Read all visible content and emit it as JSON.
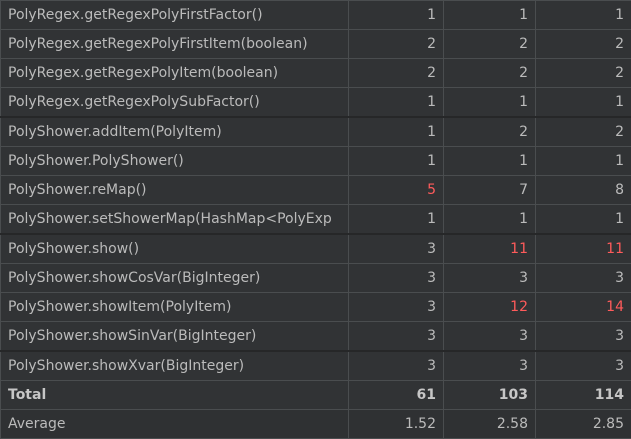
{
  "colors": {
    "background": "#313335",
    "grid": "#4a4d4f",
    "text": "#bbbbbb",
    "warning": "#ff5b5b"
  },
  "rows": [
    {
      "name": "PolyRegex.getRegexPolyFirstFactor()",
      "v1": "1",
      "v2": "1",
      "v3": "1",
      "warn": [
        false,
        false,
        false
      ],
      "group_start": false
    },
    {
      "name": "PolyRegex.getRegexPolyFirstItem(boolean)",
      "v1": "2",
      "v2": "2",
      "v3": "2",
      "warn": [
        false,
        false,
        false
      ],
      "group_start": false
    },
    {
      "name": "PolyRegex.getRegexPolyItem(boolean)",
      "v1": "2",
      "v2": "2",
      "v3": "2",
      "warn": [
        false,
        false,
        false
      ],
      "group_start": false
    },
    {
      "name": "PolyRegex.getRegexPolySubFactor()",
      "v1": "1",
      "v2": "1",
      "v3": "1",
      "warn": [
        false,
        false,
        false
      ],
      "group_start": false
    },
    {
      "name": "PolyShower.addItem(PolyItem)",
      "v1": "1",
      "v2": "2",
      "v3": "2",
      "warn": [
        false,
        false,
        false
      ],
      "group_start": true
    },
    {
      "name": "PolyShower.PolyShower()",
      "v1": "1",
      "v2": "1",
      "v3": "1",
      "warn": [
        false,
        false,
        false
      ],
      "group_start": false
    },
    {
      "name": "PolyShower.reMap()",
      "v1": "5",
      "v2": "7",
      "v3": "8",
      "warn": [
        true,
        false,
        false
      ],
      "group_start": false
    },
    {
      "name": "PolyShower.setShowerMap(HashMap<PolyExp",
      "v1": "1",
      "v2": "1",
      "v3": "1",
      "warn": [
        false,
        false,
        false
      ],
      "group_start": false
    },
    {
      "name": "PolyShower.show()",
      "v1": "3",
      "v2": "11",
      "v3": "11",
      "warn": [
        false,
        true,
        true
      ],
      "group_start": true
    },
    {
      "name": "PolyShower.showCosVar(BigInteger)",
      "v1": "3",
      "v2": "3",
      "v3": "3",
      "warn": [
        false,
        false,
        false
      ],
      "group_start": false
    },
    {
      "name": "PolyShower.showItem(PolyItem)",
      "v1": "3",
      "v2": "12",
      "v3": "14",
      "warn": [
        false,
        true,
        true
      ],
      "group_start": false
    },
    {
      "name": "PolyShower.showSinVar(BigInteger)",
      "v1": "3",
      "v2": "3",
      "v3": "3",
      "warn": [
        false,
        false,
        false
      ],
      "group_start": false
    },
    {
      "name": "PolyShower.showXvar(BigInteger)",
      "v1": "3",
      "v2": "3",
      "v3": "3",
      "warn": [
        false,
        false,
        false
      ],
      "group_start": true
    }
  ],
  "total": {
    "label": "Total",
    "v1": "61",
    "v2": "103",
    "v3": "114"
  },
  "average": {
    "label": "Average",
    "v1": "1.52",
    "v2": "2.58",
    "v3": "2.85"
  }
}
